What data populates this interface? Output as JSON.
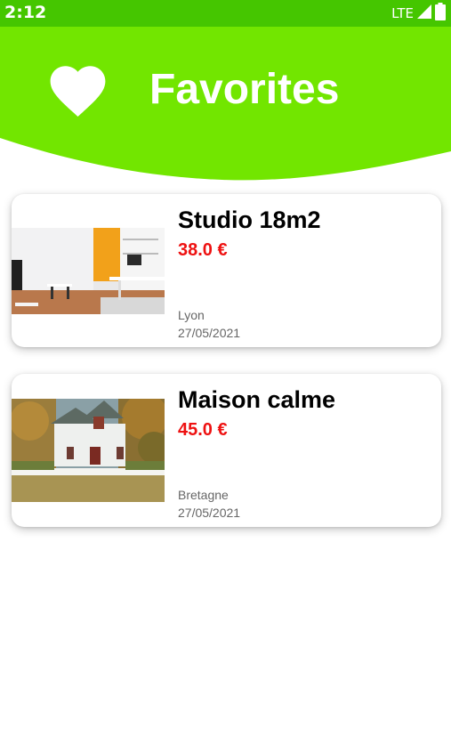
{
  "status_bar": {
    "time": "2:12",
    "network": "LTE",
    "background_color": "#45c600",
    "icons": [
      "signal-icon",
      "battery-icon"
    ]
  },
  "header": {
    "title": "Favorites",
    "icon": "heart-icon",
    "background_color": "#72e600"
  },
  "favorites": [
    {
      "title": "Studio 18m2",
      "price": "38.0 €",
      "city": "Lyon",
      "date": "27/05/2021"
    },
    {
      "title": "Maison calme",
      "price": "45.0 €",
      "city": "Bretagne",
      "date": "27/05/2021"
    }
  ],
  "colors": {
    "price": "#ee1111",
    "meta_text": "#666666"
  }
}
